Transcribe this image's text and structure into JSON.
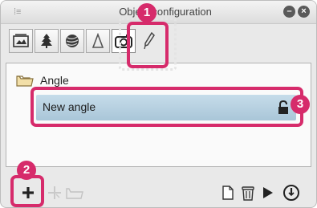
{
  "window": {
    "title": "Object configuration",
    "menu_icon": "grip-icon",
    "collapse_icon": "collapse-icon",
    "close_icon": "close-icon"
  },
  "tabs": [
    {
      "icon": "scene-tab-icon"
    },
    {
      "icon": "tree-tab-icon"
    },
    {
      "icon": "texture-tab-icon"
    },
    {
      "icon": "layout-tab-icon"
    },
    {
      "icon": "camera-tab-icon",
      "active": true
    },
    {
      "icon": "pen-tab-icon"
    }
  ],
  "list": {
    "folder": {
      "label": "Angle",
      "icon": "folder-icon"
    },
    "items": [
      {
        "label": "New angle",
        "selected": true,
        "icon": "lock-icon"
      }
    ]
  },
  "toolbar": {
    "add_icon": "add-icon",
    "add_to_folder_icon": "add-folder-icon",
    "new_folder_icon": "new-folder-icon",
    "copy_icon": "copy-icon",
    "delete_icon": "delete-icon",
    "play_icon": "play-icon",
    "power_icon": "power-icon"
  },
  "callouts": [
    "1",
    "2",
    "3"
  ],
  "colors": {
    "callout": "#d62b6b",
    "selection": "#b6d0e0",
    "panel": "#e9e9e9"
  }
}
